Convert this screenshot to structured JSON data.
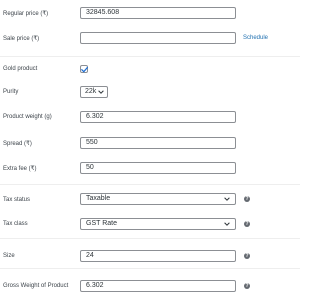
{
  "general": {
    "regular_price": {
      "label": "Regular price (₹)",
      "value": "32845.608"
    },
    "sale_price": {
      "label": "Sale price (₹)",
      "value": "",
      "schedule_link": "Schedule"
    }
  },
  "gold": {
    "gold_product": {
      "label": "Gold product",
      "checked": true
    },
    "purity": {
      "label": "Purity",
      "value": "22k"
    },
    "product_weight": {
      "label": "Product weight (g)",
      "value": "6.302"
    },
    "spread": {
      "label": "Spread (₹)",
      "value": "550"
    },
    "extra_fee": {
      "label": "Extra fee (₹)",
      "value": "50"
    }
  },
  "tax": {
    "tax_status": {
      "label": "Tax status",
      "value": "Taxable"
    },
    "tax_class": {
      "label": "Tax class",
      "value": "GST Rate"
    }
  },
  "custom": {
    "size": {
      "label": "Size",
      "value": "24"
    },
    "gross_weight": {
      "label": "Gross Weight of Product",
      "value": "6.302"
    }
  },
  "icons": {
    "help": "help-icon",
    "chevron": "chevron-down-icon",
    "check": "check-icon"
  },
  "colors": {
    "link": "#2271b1",
    "border": "#8c8f94",
    "help_bg": "#646970"
  }
}
